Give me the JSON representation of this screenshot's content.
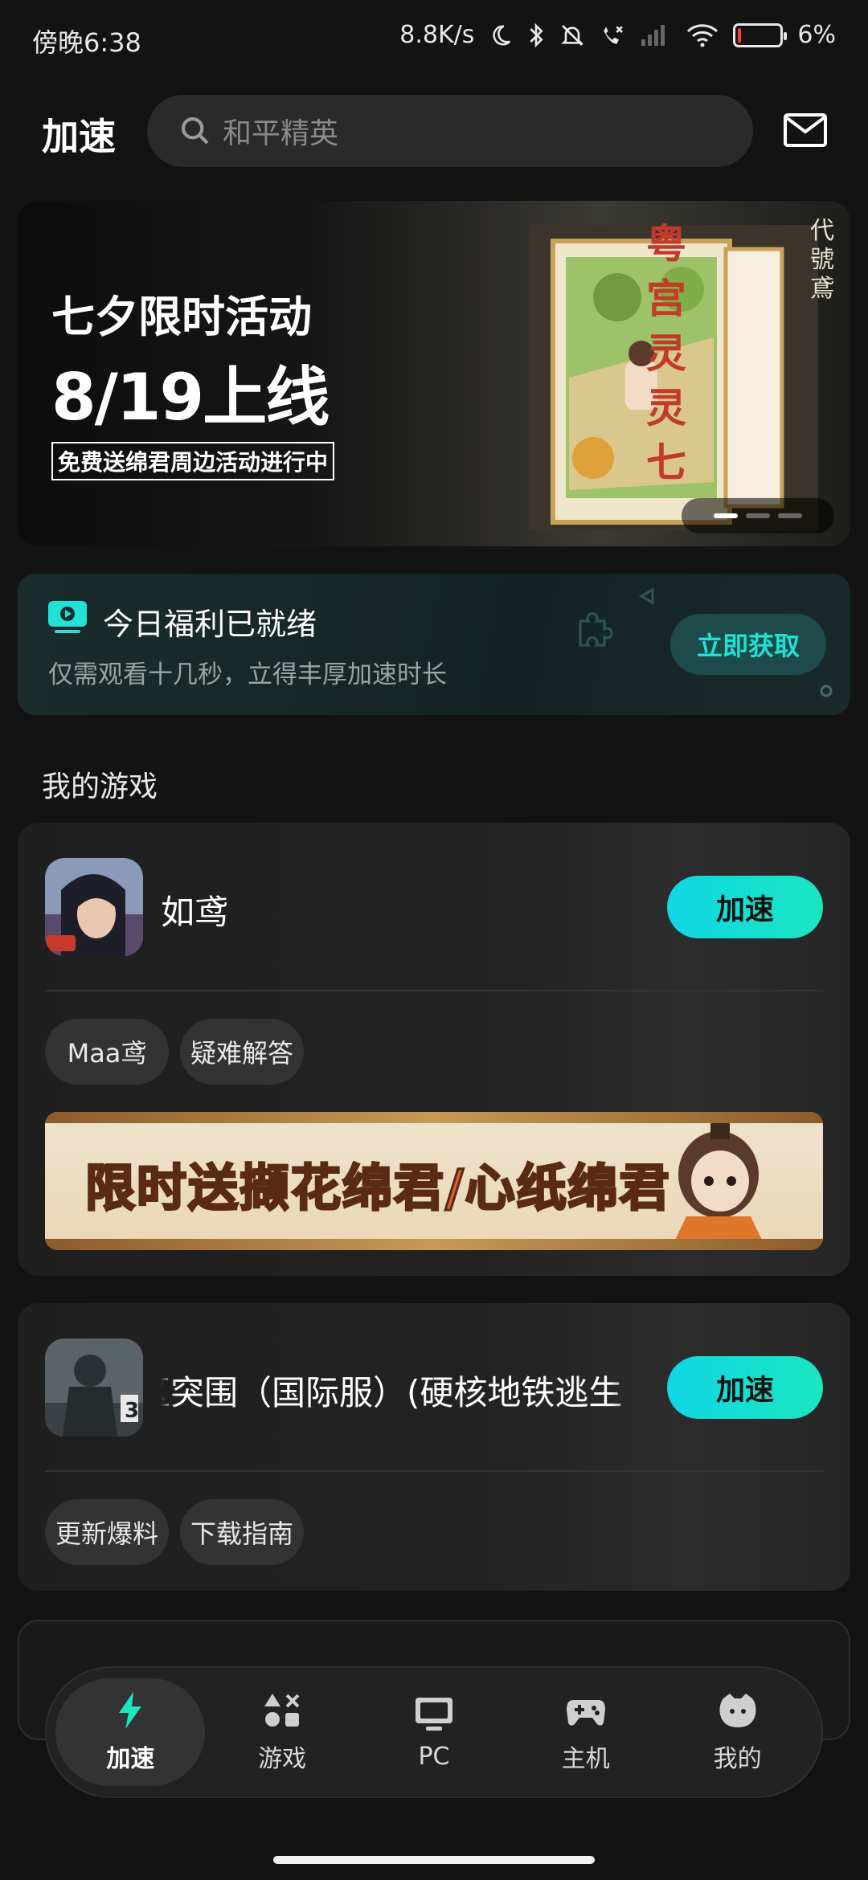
{
  "status_bar": {
    "time": "傍晚6:38",
    "net_speed": "8.8K/s",
    "battery_text": "6%",
    "battery_level": 0.06
  },
  "header": {
    "title": "加速",
    "search_placeholder": "和平精英"
  },
  "banner": {
    "title": "七夕限时活动",
    "date": "8/19上线",
    "tag": "免费送绵君周边活动进行中",
    "art_title": "粤宫灵灵七",
    "art_brand": "代號鳶",
    "page_count": 3,
    "active_page": 0
  },
  "welfare": {
    "title": "今日福利已就绪",
    "subtitle": "仅需观看十几秒，立得丰厚加速时长",
    "button": "立即获取",
    "accent": "#21e0d4"
  },
  "my_games": {
    "section_title": "我的游戏",
    "games": [
      {
        "name": "如鸢",
        "speed_button": "加速",
        "chips": [
          "Maa鸢",
          "疑难解答"
        ],
        "promo_text": "限时送撷花绵君/心纸绵君"
      },
      {
        "name": "暗区突围（国际服）(硬核地铁逃生",
        "speed_button": "加速",
        "chips": [
          "更新爆料",
          "下载指南"
        ]
      }
    ]
  },
  "bottom_nav": {
    "items": [
      {
        "label": "加速",
        "icon": "lightning-icon",
        "active": true
      },
      {
        "label": "游戏",
        "icon": "games-grid-icon",
        "active": false
      },
      {
        "label": "PC",
        "icon": "monitor-icon",
        "active": false
      },
      {
        "label": "主机",
        "icon": "gamepad-icon",
        "active": false
      },
      {
        "label": "我的",
        "icon": "profile-face-icon",
        "active": false
      }
    ],
    "accent": "#19e6c0"
  }
}
